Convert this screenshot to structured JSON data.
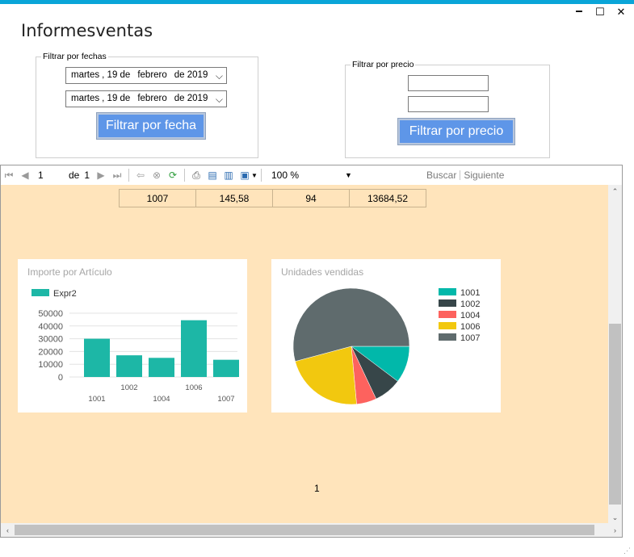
{
  "window": {
    "title": "Informesventas",
    "controls": {
      "minimize": "🗕",
      "maximize": "☐",
      "close": "✕"
    }
  },
  "date_filter": {
    "legend": "Filtrar por fechas",
    "from": {
      "weekday": "martes",
      "day": ", 19 de",
      "month": "febrero",
      "year": "de 2019"
    },
    "to": {
      "weekday": "martes",
      "day": ", 19 de",
      "month": "febrero",
      "year": "de 2019"
    },
    "button_label": "Filtrar por fecha"
  },
  "price_filter": {
    "legend": "Filtrar por precio",
    "min_value": "",
    "max_value": "",
    "button_label": "Filtrar por precio"
  },
  "toolbar": {
    "current_page": "1",
    "of_label": "de",
    "total_pages": "1",
    "zoom": "100 %",
    "find_label": "Buscar",
    "next_label": "Siguiente"
  },
  "report": {
    "row": [
      "1007",
      "145,58",
      "94",
      "13684,52"
    ],
    "page_number": "1"
  },
  "chart_data": [
    {
      "type": "bar",
      "title": "Importe por Artículo",
      "categories": [
        "1001",
        "1002",
        "1004",
        "1006",
        "1007"
      ],
      "series": [
        {
          "name": "Expr2",
          "values": [
            30000,
            17000,
            15000,
            44500,
            13500
          ],
          "color": "#1db7a6"
        }
      ],
      "yticks": [
        "50000",
        "40000",
        "30000",
        "20000",
        "10000",
        "0"
      ],
      "ylim": [
        0,
        50000
      ],
      "grid": true,
      "legend": "top-left"
    },
    {
      "type": "pie",
      "title": "Unidades vendidas",
      "categories": [
        "1001",
        "1002",
        "1004",
        "1006",
        "1007"
      ],
      "values": [
        48,
        36,
        26,
        104,
        253
      ],
      "colors": [
        "#01b8aa",
        "#374649",
        "#fd625e",
        "#f2c80f",
        "#5f6b6d"
      ],
      "legend": "right"
    }
  ]
}
